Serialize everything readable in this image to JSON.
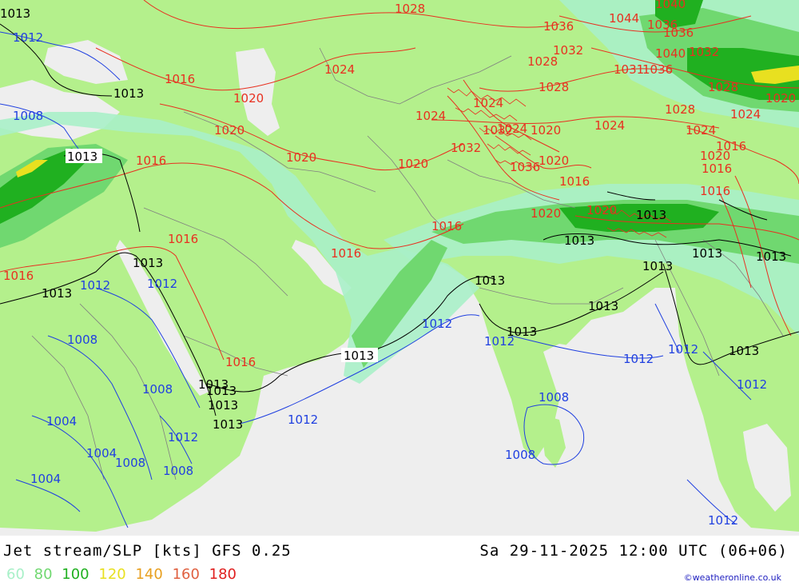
{
  "title": "Jet stream/SLP [kts] GFS 0.25",
  "datetime": "Sa 29-11-2025 12:00 UTC (06+06)",
  "credit": "©weatheronline.co.uk",
  "legend": [
    {
      "label": "60",
      "color": "#a8f0c8"
    },
    {
      "label": "80",
      "color": "#70d870"
    },
    {
      "label": "100",
      "color": "#20b020"
    },
    {
      "label": "120",
      "color": "#e8e020"
    },
    {
      "label": "140",
      "color": "#e8a020"
    },
    {
      "label": "160",
      "color": "#e06040"
    },
    {
      "label": "180",
      "color": "#e02020"
    }
  ],
  "colors": {
    "land": "#b4f08c",
    "sea": "#eeeeee",
    "isobar_high": "#e83020",
    "isobar_mid": "#000000",
    "isobar_low": "#2040e0"
  },
  "isobar_labels": {
    "high": [
      "1028",
      "1036",
      "1044",
      "1040",
      "1036",
      "1036",
      "1032",
      "1040",
      "1032",
      "1028",
      "1020",
      "1024",
      "1016",
      "1020",
      "1020",
      "1028",
      "1032",
      "1031",
      "1036",
      "1024",
      "1024",
      "1032",
      "1028",
      "1020",
      "1024",
      "1024",
      "1028",
      "1024",
      "1020",
      "1024",
      "1036",
      "1020",
      "1016",
      "1016",
      "1016",
      "1016",
      "1016",
      "1016",
      "1020",
      "1020",
      "1020",
      "1020",
      "1016",
      "1016",
      "1016",
      "1016"
    ],
    "mid": [
      "1013",
      "1013",
      "1013",
      "1013",
      "1013",
      "1013",
      "1013",
      "1013",
      "1013",
      "1013",
      "1013",
      "1013",
      "1013",
      "1013",
      "1013",
      "1013",
      "1013",
      "1013",
      "1013"
    ],
    "low": [
      "1012",
      "1008",
      "1012",
      "1012",
      "1012",
      "1008",
      "1012",
      "1012",
      "1012",
      "1008",
      "1008",
      "1004",
      "1008",
      "1004",
      "1008",
      "1012",
      "1012",
      "1008",
      "1004",
      "1012"
    ]
  }
}
